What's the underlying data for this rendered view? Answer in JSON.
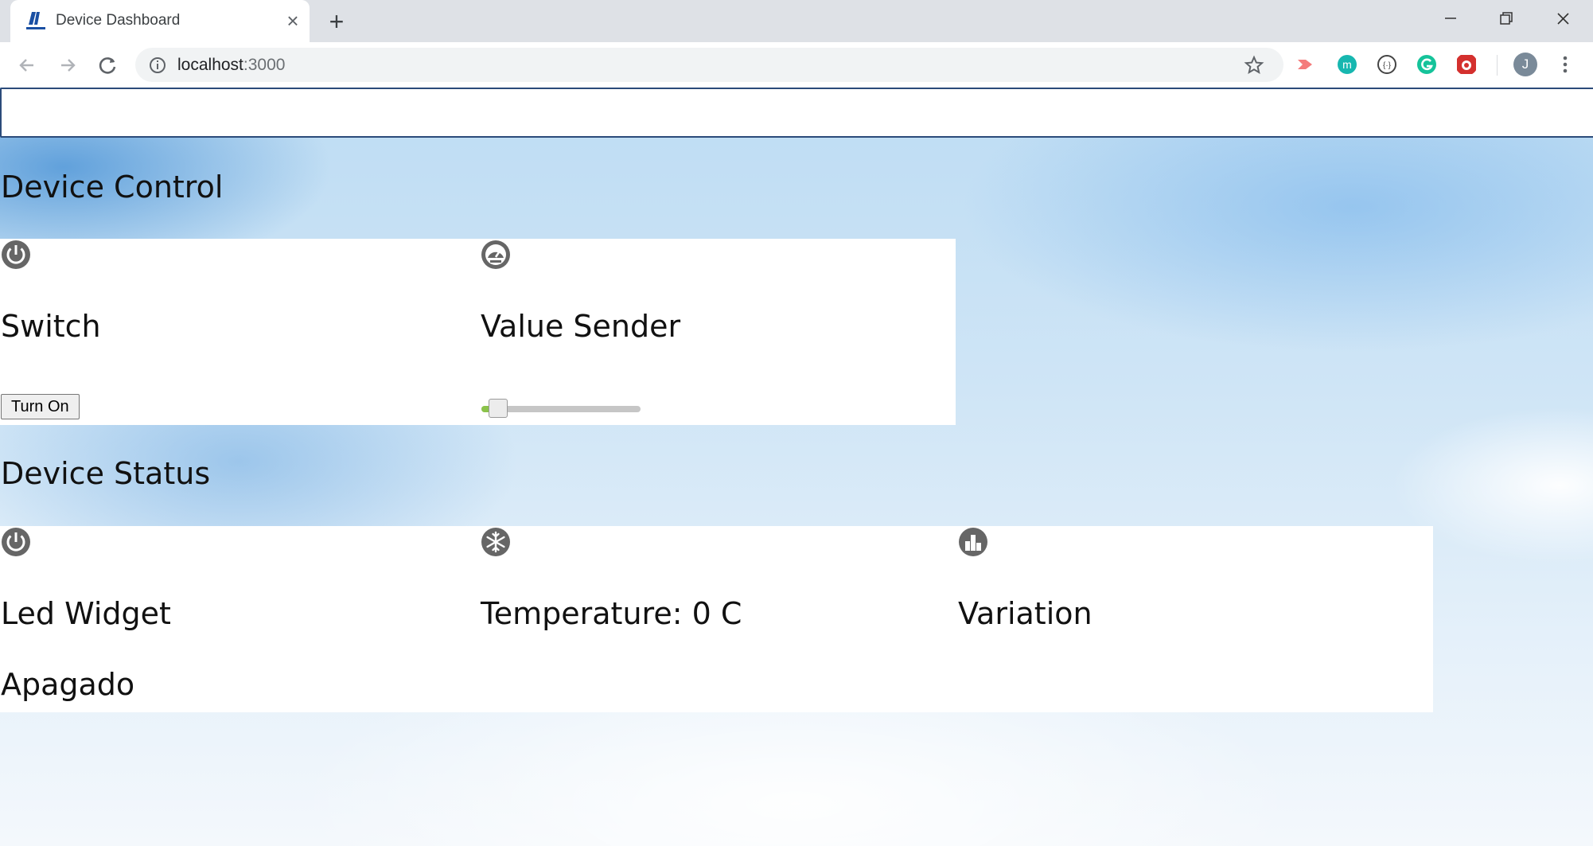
{
  "browser": {
    "tab_title": "Device Dashboard",
    "url_host": "localhost",
    "url_port": ":3000",
    "profile_initial": "J",
    "extension_icons": [
      "record-icon",
      "m-icon",
      "dev-tools-icon",
      "grammarly-icon",
      "bug-icon"
    ]
  },
  "page": {
    "search_value": "",
    "control_section_title": "Device Control",
    "status_section_title": "Device Status",
    "control_widgets": {
      "switch": {
        "icon": "power-icon",
        "title": "Switch",
        "button_label": "Turn On"
      },
      "value_sender": {
        "icon": "gauge-icon",
        "title": "Value Sender",
        "slider_value_fraction": 0.05
      }
    },
    "status_widgets": {
      "led": {
        "icon": "power-icon",
        "title": "Led Widget",
        "status": "Apagado"
      },
      "temperature": {
        "icon": "snowflake-icon",
        "title": "Temperature: 0 C"
      },
      "variation": {
        "icon": "bar-chart-icon",
        "title": "Variation"
      }
    }
  },
  "colors": {
    "widget_icon": "#666666",
    "slider_fill": "#8bc34a",
    "input_border": "#2b4b7a"
  }
}
